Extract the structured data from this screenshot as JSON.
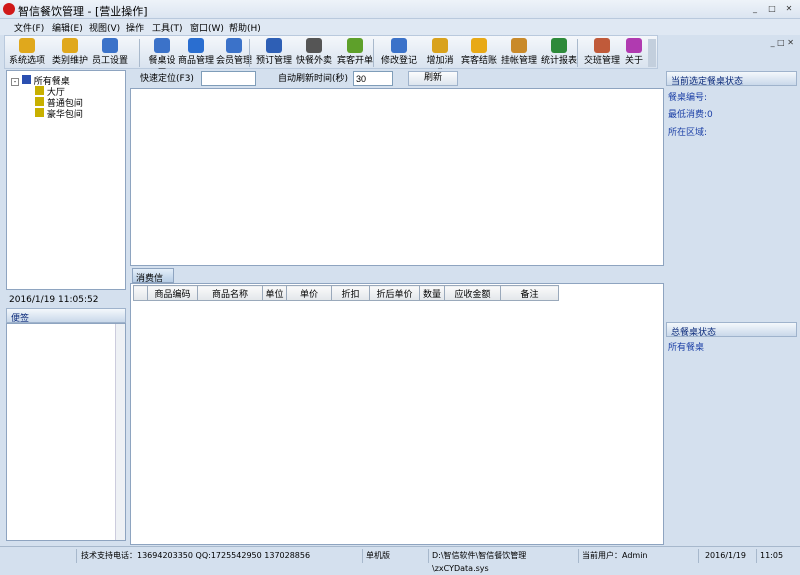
{
  "window": {
    "title": "智信餐饮管理 - [营业操作]"
  },
  "menu": [
    "文件(F)",
    "编辑(E)",
    "视图(V)",
    "操作",
    "工具(T)",
    "窗口(W)",
    "帮助(H)"
  ],
  "toolbar": [
    {
      "label": "系统选项",
      "icon": "key-icon",
      "color": "#e0a81c"
    },
    {
      "label": "类别维护",
      "icon": "key-icon",
      "color": "#e0a81c"
    },
    {
      "label": "员工设置",
      "icon": "user-icon",
      "color": "#3b72c9"
    },
    {
      "label": "餐桌设置",
      "icon": "table-icon",
      "color": "#3b72c9"
    },
    {
      "label": "商品管理",
      "icon": "box-icon",
      "color": "#2a6ed0"
    },
    {
      "label": "会员管理",
      "icon": "member-icon",
      "color": "#3b72c9"
    },
    {
      "label": "预订管理",
      "icon": "stapler-icon",
      "color": "#2e5fb5"
    },
    {
      "label": "快餐外卖",
      "icon": "phone-icon",
      "color": "#555555"
    },
    {
      "label": "宾客开单",
      "icon": "money-icon",
      "color": "#5ea02a"
    },
    {
      "label": "修改登记",
      "icon": "user-edit-icon",
      "color": "#3b72c9"
    },
    {
      "label": "增加消费",
      "icon": "add-icon",
      "color": "#d9a21c"
    },
    {
      "label": "宾客结账",
      "icon": "coin-icon",
      "color": "#e8a916"
    },
    {
      "label": "挂帐管理",
      "icon": "bag-icon",
      "color": "#c98a2a"
    },
    {
      "label": "统计报表",
      "icon": "chart-icon",
      "color": "#2d8a3a"
    },
    {
      "label": "交班管理",
      "icon": "users-icon",
      "color": "#c05a3a"
    },
    {
      "label": "关于",
      "icon": "question-icon",
      "color": "#b03ab0"
    }
  ],
  "tree": {
    "root": "所有餐桌",
    "children": [
      "大厅",
      "普通包间",
      "豪华包间"
    ]
  },
  "datetime": "2016/1/19 11:05:52",
  "notes": {
    "title": "便签"
  },
  "quick": {
    "locate_label": "快速定位(F3)",
    "locate_value": "",
    "refresh_label": "自动刷新时间(秒)",
    "refresh_value": "30",
    "refresh_button": "刷新"
  },
  "consumption": {
    "tab": "消费信息",
    "columns": [
      "",
      "商品编码",
      "商品名称",
      "单位",
      "单价",
      "折扣",
      "折后单价",
      "数量",
      "应收金额",
      "备注"
    ]
  },
  "right": {
    "selected_title": "当前选定餐桌状态",
    "table_no": "餐桌编号:",
    "min_consume": "最低消费:0",
    "area": "所在区域:",
    "total_title": "总餐桌状态",
    "all_tables": "所有餐桌"
  },
  "status": {
    "support": "技术支持电话：13694203350 QQ:1725542950 137028856",
    "mode": "单机版",
    "path": "D:\\智信软件\\智信餐饮管理\\zxCYData.sys",
    "user": "当前用户：Admin",
    "date": "2016/1/19",
    "time": "11:05"
  }
}
